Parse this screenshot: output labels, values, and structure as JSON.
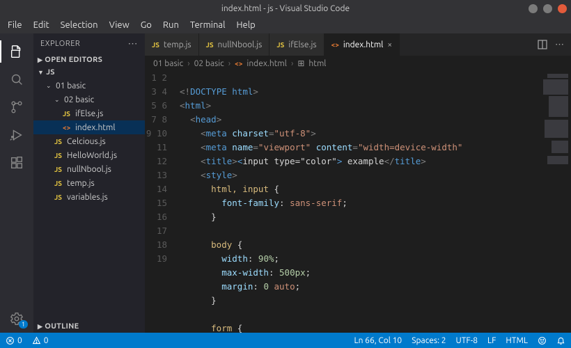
{
  "title": "index.html - js - Visual Studio Code",
  "menubar": [
    "File",
    "Edit",
    "Selection",
    "View",
    "Go",
    "Run",
    "Terminal",
    "Help"
  ],
  "window_controls": {
    "min": "#7b7b7b",
    "max": "#7b7b7b",
    "close": "#e35b3b"
  },
  "activitybar": {
    "settings_badge": "1"
  },
  "sidebar": {
    "title": "EXPLORER",
    "open_editors": "OPEN EDITORS",
    "workspace": "JS",
    "outline": "OUTLINE",
    "tree": [
      {
        "type": "folder",
        "name": "01 basic",
        "depth": 1
      },
      {
        "type": "folder",
        "name": "02 basic",
        "depth": 2
      },
      {
        "type": "file",
        "name": "ifElse.js",
        "icon": "js",
        "depth": 3
      },
      {
        "type": "file",
        "name": "index.html",
        "icon": "html",
        "depth": 3,
        "selected": true
      },
      {
        "type": "file",
        "name": "Celcious.js",
        "icon": "js",
        "depth": 2
      },
      {
        "type": "file",
        "name": "HelloWorld.js",
        "icon": "js",
        "depth": 2
      },
      {
        "type": "file",
        "name": "nullNbool.js",
        "icon": "js",
        "depth": 2
      },
      {
        "type": "file",
        "name": "temp.js",
        "icon": "js",
        "depth": 2
      },
      {
        "type": "file",
        "name": "variables.js",
        "icon": "js",
        "depth": 2
      }
    ]
  },
  "tabs": [
    {
      "label": "temp.js",
      "icon": "js",
      "active": false
    },
    {
      "label": "nullNbool.js",
      "icon": "js",
      "active": false
    },
    {
      "label": "ifElse.js",
      "icon": "js",
      "active": false
    },
    {
      "label": "index.html",
      "icon": "html",
      "active": true
    }
  ],
  "breadcrumb": [
    "01 basic",
    "02 basic",
    "index.html",
    "html"
  ],
  "code": {
    "start_line": 1,
    "lines": [
      [],
      [
        [
          "punc",
          "<!"
        ],
        [
          "doctype",
          "DOCTYPE html"
        ],
        [
          "punc",
          ">"
        ]
      ],
      [
        [
          "punc",
          "<"
        ],
        [
          "tag",
          "html"
        ],
        [
          "punc",
          ">"
        ]
      ],
      [
        [
          "text",
          "  "
        ],
        [
          "punc",
          "<"
        ],
        [
          "tag",
          "head"
        ],
        [
          "punc",
          ">"
        ]
      ],
      [
        [
          "text",
          "    "
        ],
        [
          "punc",
          "<"
        ],
        [
          "tag",
          "meta"
        ],
        [
          "text",
          " "
        ],
        [
          "attr",
          "charset"
        ],
        [
          "punc",
          "="
        ],
        [
          "str",
          "\"utf-8\""
        ],
        [
          "punc",
          ">"
        ]
      ],
      [
        [
          "text",
          "    "
        ],
        [
          "punc",
          "<"
        ],
        [
          "tag",
          "meta"
        ],
        [
          "text",
          " "
        ],
        [
          "attr",
          "name"
        ],
        [
          "punc",
          "="
        ],
        [
          "str",
          "\"viewport\""
        ],
        [
          "text",
          " "
        ],
        [
          "attr",
          "content"
        ],
        [
          "punc",
          "="
        ],
        [
          "str",
          "\"width=device-width\""
        ]
      ],
      [
        [
          "text",
          "    "
        ],
        [
          "punc",
          "<"
        ],
        [
          "tag",
          "title"
        ],
        [
          "punc",
          ">"
        ],
        [
          "ent",
          "&lt;"
        ],
        [
          "text",
          "input type=\"color\""
        ],
        [
          "ent",
          "&gt;"
        ],
        [
          "text",
          " example"
        ],
        [
          "punc",
          "</"
        ],
        [
          "tag",
          "title"
        ],
        [
          "punc",
          ">"
        ]
      ],
      [
        [
          "text",
          "    "
        ],
        [
          "punc",
          "<"
        ],
        [
          "tag",
          "style"
        ],
        [
          "punc",
          ">"
        ]
      ],
      [
        [
          "text",
          "      "
        ],
        [
          "sel",
          "html, input"
        ],
        [
          "text",
          " {"
        ]
      ],
      [
        [
          "text",
          "        "
        ],
        [
          "prop",
          "font-family"
        ],
        [
          "colon",
          ": "
        ],
        [
          "val",
          "sans-serif"
        ],
        [
          "text",
          ";"
        ]
      ],
      [
        [
          "text",
          "      }"
        ]
      ],
      [],
      [
        [
          "text",
          "      "
        ],
        [
          "sel",
          "body"
        ],
        [
          "text",
          " {"
        ]
      ],
      [
        [
          "text",
          "        "
        ],
        [
          "prop",
          "width"
        ],
        [
          "colon",
          ": "
        ],
        [
          "num",
          "90%"
        ],
        [
          "text",
          ";"
        ]
      ],
      [
        [
          "text",
          "        "
        ],
        [
          "prop",
          "max-width"
        ],
        [
          "colon",
          ": "
        ],
        [
          "num",
          "500px"
        ],
        [
          "text",
          ";"
        ]
      ],
      [
        [
          "text",
          "        "
        ],
        [
          "prop",
          "margin"
        ],
        [
          "colon",
          ": "
        ],
        [
          "num",
          "0"
        ],
        [
          "text",
          " "
        ],
        [
          "val",
          "auto"
        ],
        [
          "text",
          ";"
        ]
      ],
      [
        [
          "text",
          "      }"
        ]
      ],
      [],
      [
        [
          "text",
          "      "
        ],
        [
          "sel",
          "form"
        ],
        [
          "text",
          " {"
        ]
      ]
    ]
  },
  "statusbar": {
    "errors": "0",
    "warnings": "0",
    "cursor": "Ln 66, Col 10",
    "spaces": "Spaces: 2",
    "encoding": "UTF-8",
    "eol": "LF",
    "lang": "HTML"
  }
}
